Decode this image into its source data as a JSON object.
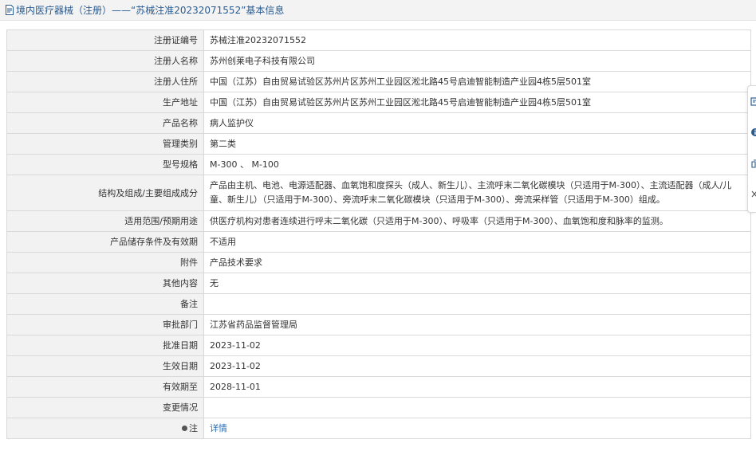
{
  "header": {
    "title": "境内医疗器械（注册）——“苏械注准20232071552”基本信息",
    "icon": "document-icon"
  },
  "rows": [
    {
      "label": "注册证编号",
      "value": "苏械注准20232071552"
    },
    {
      "label": "注册人名称",
      "value": "苏州创莱电子科技有限公司"
    },
    {
      "label": "注册人住所",
      "value": "中国（江苏）自由贸易试验区苏州片区苏州工业园区淞北路45号启迪智能制造产业园4栋5层501室"
    },
    {
      "label": "生产地址",
      "value": "中国（江苏）自由贸易试验区苏州片区苏州工业园区淞北路45号启迪智能制造产业园4栋5层501室"
    },
    {
      "label": "产品名称",
      "value": "病人监护仪"
    },
    {
      "label": "管理类别",
      "value": "第二类"
    },
    {
      "label": "型号规格",
      "value": "M-300 、 M-100"
    },
    {
      "label": "结构及组成/主要组成成分",
      "value": "产品由主机、电池、电源适配器、血氧饱和度探头（成人、新生儿）、主流呼末二氧化碳模块（只适用于M-300）、主流适配器（成人/儿童、新生儿）（只适用于M-300）、旁流呼末二氧化碳模块（只适用于M-300）、旁流采样管（只适用于M-300）组成。"
    },
    {
      "label": "适用范围/预期用途",
      "value": "供医疗机构对患者连续进行呼末二氧化碳（只适用于M-300）、呼吸率（只适用于M-300）、血氧饱和度和脉率的监测。"
    },
    {
      "label": "产品储存条件及有效期",
      "value": "不适用"
    },
    {
      "label": "附件",
      "value": "产品技术要求"
    },
    {
      "label": "其他内容",
      "value": "无"
    },
    {
      "label": "备注",
      "value": ""
    },
    {
      "label": "审批部门",
      "value": "江苏省药品监督管理局"
    },
    {
      "label": "批准日期",
      "value": "2023-11-02"
    },
    {
      "label": "生效日期",
      "value": "2023-11-02"
    },
    {
      "label": "有效期至",
      "value": "2028-11-01"
    },
    {
      "label": "变更情况",
      "value": ""
    }
  ],
  "note": {
    "label": "注",
    "link": "详情"
  },
  "side_panel": {
    "icons": [
      "feedback-icon",
      "info-icon",
      "share-icon",
      "collapse-icon"
    ]
  }
}
